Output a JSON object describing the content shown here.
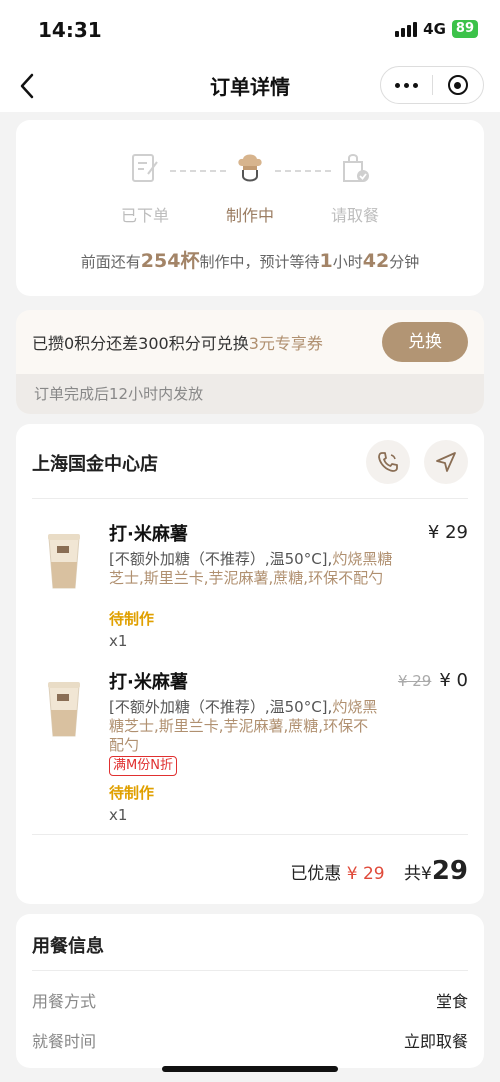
{
  "status_bar": {
    "time": "14:31",
    "network": "4G",
    "battery": "89"
  },
  "nav": {
    "title": "订单详情"
  },
  "progress": {
    "steps": [
      {
        "label": "已下单",
        "icon": "order-icon"
      },
      {
        "label": "制作中",
        "icon": "chef-icon"
      },
      {
        "label": "请取餐",
        "icon": "bag-icon"
      }
    ],
    "active_step": 1,
    "wait": {
      "prefix": "前面还有",
      "cups": "254杯",
      "middle": "制作中，预计等待",
      "hours": "1",
      "hours_unit": "小时",
      "minutes": "42",
      "minutes_unit": "分钟"
    }
  },
  "points": {
    "text_prefix": "已攒0积分还差300积分可兑换",
    "highlight": "3元专享券",
    "button": "兑换",
    "note": "订单完成后12小时内发放"
  },
  "order": {
    "store": "上海国金中心店",
    "items": [
      {
        "name": "打·米麻薯",
        "desc_main": "[不额外加糖（不推荐）,温50°C],",
        "desc_extra": "灼烧黑糖芝士,斯里兰卡,芋泥麻薯,蔗糖,环保不配勺",
        "status": "待制作",
        "qty": "x1",
        "price": "¥ 29",
        "orig_price": "",
        "promo": ""
      },
      {
        "name": "打·米麻薯",
        "desc_main": "[不额外加糖（不推荐）,温50°C],",
        "desc_extra": "灼烧黑糖芝士,斯里兰卡,芋泥麻薯,蔗糖,环保不配勺",
        "status": "待制作",
        "qty": "x1",
        "price": "¥ 0",
        "orig_price": "¥ 29",
        "promo": "满M份N折"
      }
    ],
    "discount_label": "已优惠",
    "discount": "¥ 29",
    "total_label": "共",
    "total_currency": "¥",
    "total": "29"
  },
  "dining": {
    "title": "用餐信息",
    "rows": [
      {
        "key": "用餐方式",
        "value": "堂食"
      },
      {
        "key": "就餐时间",
        "value": "立即取餐"
      }
    ]
  },
  "colors": {
    "accent": "#b29574",
    "accent_text": "#a38467",
    "status": "#e0a000",
    "discount": "#e04a3a"
  }
}
